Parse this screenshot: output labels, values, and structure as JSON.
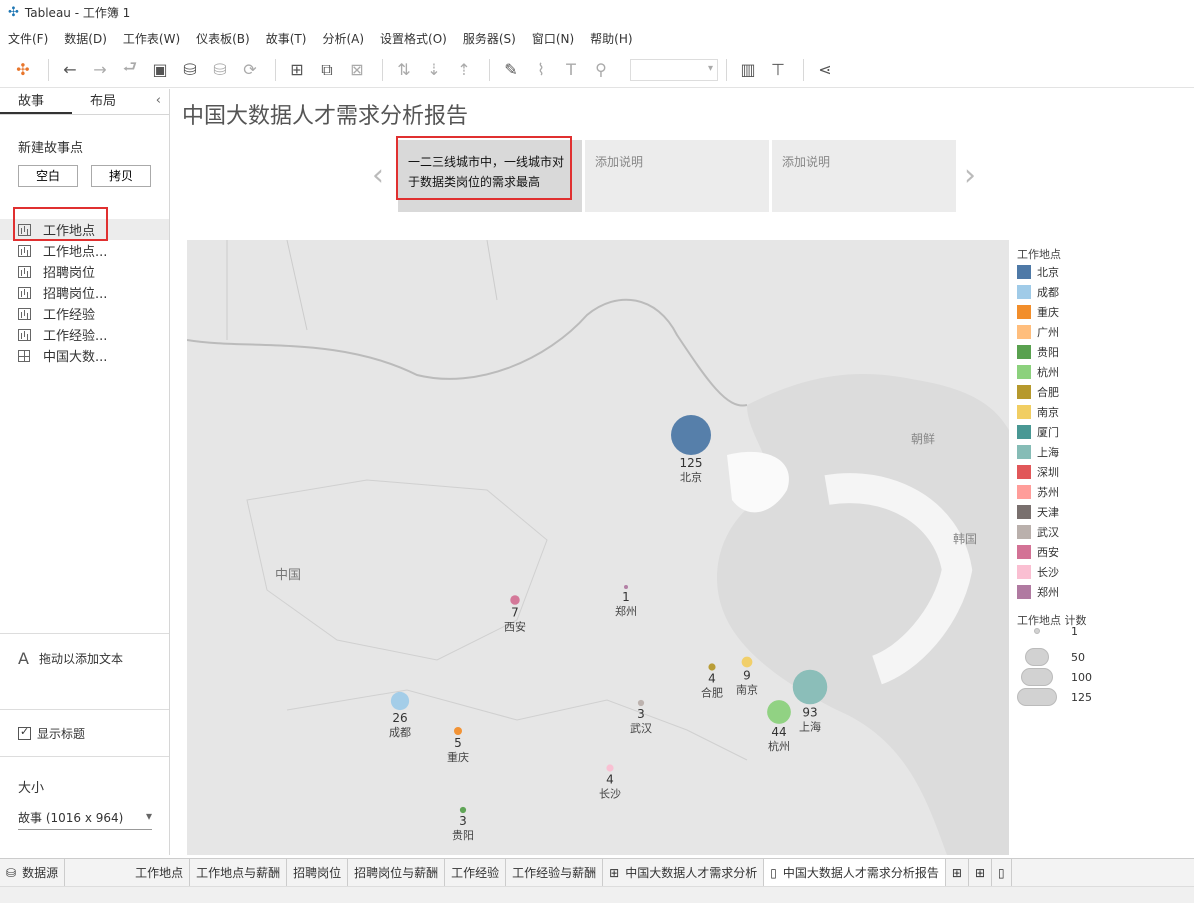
{
  "window": {
    "title": "Tableau - 工作簿 1"
  },
  "menu": [
    "文件(F)",
    "数据(D)",
    "工作表(W)",
    "仪表板(B)",
    "故事(T)",
    "分析(A)",
    "设置格式(O)",
    "服务器(S)",
    "窗口(N)",
    "帮助(H)"
  ],
  "sidebar": {
    "tabs": [
      "故事",
      "布局"
    ],
    "new_point_label": "新建故事点",
    "blank_button": "空白",
    "copy_button": "拷贝",
    "sheets": [
      "工作地点",
      "工作地点...",
      "招聘岗位",
      "招聘岗位...",
      "工作经验",
      "工作经验...",
      "中国大数..."
    ],
    "drag_text": "拖动以添加文本",
    "show_title": "显示标题",
    "size_label": "大小",
    "size_value": "故事 (1016 x 964)"
  },
  "story": {
    "title": "中国大数据人才需求分析报告",
    "points": [
      "一二三线城市中，一线城市对于数据类岗位的需求最高",
      "添加说明",
      "添加说明"
    ]
  },
  "map": {
    "country_label": "中国",
    "korea_north": "朝鲜",
    "korea_south": "韩国",
    "cities": [
      {
        "name": "北京",
        "count": 125,
        "color": "#4e79a7"
      },
      {
        "name": "上海",
        "count": 93,
        "color": "#86bcb6"
      },
      {
        "name": "杭州",
        "count": 44,
        "color": "#8cd17d"
      },
      {
        "name": "成都",
        "count": 26,
        "color": "#a0cbe8"
      },
      {
        "name": "南京",
        "count": 9,
        "color": "#f1ce63"
      },
      {
        "name": "西安",
        "count": 7,
        "color": "#d37295"
      },
      {
        "name": "重庆",
        "count": 5,
        "color": "#f28e2b"
      },
      {
        "name": "合肥",
        "count": 4,
        "color": "#b6992d"
      },
      {
        "name": "长沙",
        "count": 4,
        "color": "#fabfd2"
      },
      {
        "name": "武汉",
        "count": 3,
        "color": "#bab0ac"
      },
      {
        "name": "贵阳",
        "count": 3,
        "color": "#59a14f"
      },
      {
        "name": "郑州",
        "count": 1,
        "color": "#b07aa1"
      }
    ]
  },
  "legend": {
    "color_title": "工作地点",
    "items": [
      {
        "label": "北京",
        "color": "#4e79a7"
      },
      {
        "label": "成都",
        "color": "#a0cbe8"
      },
      {
        "label": "重庆",
        "color": "#f28e2b"
      },
      {
        "label": "广州",
        "color": "#ffbe7d"
      },
      {
        "label": "贵阳",
        "color": "#59a14f"
      },
      {
        "label": "杭州",
        "color": "#8cd17d"
      },
      {
        "label": "合肥",
        "color": "#b6992d"
      },
      {
        "label": "南京",
        "color": "#f1ce63"
      },
      {
        "label": "厦门",
        "color": "#499894"
      },
      {
        "label": "上海",
        "color": "#86bcb6"
      },
      {
        "label": "深圳",
        "color": "#e15759"
      },
      {
        "label": "苏州",
        "color": "#ff9d9a"
      },
      {
        "label": "天津",
        "color": "#79706e"
      },
      {
        "label": "武汉",
        "color": "#bab0ac"
      },
      {
        "label": "西安",
        "color": "#d37295"
      },
      {
        "label": "长沙",
        "color": "#fabfd2"
      },
      {
        "label": "郑州",
        "color": "#b07aa1"
      }
    ],
    "size_title": "工作地点 计数",
    "sizes": [
      "1",
      "50",
      "100",
      "125"
    ]
  },
  "bottom_tabs": [
    "数据源",
    "工作地点",
    "工作地点与薪酬",
    "招聘岗位",
    "招聘岗位与薪酬",
    "工作经验",
    "工作经验与薪酬",
    "中国大数据人才需求分析",
    "中国大数据人才需求分析报告"
  ]
}
